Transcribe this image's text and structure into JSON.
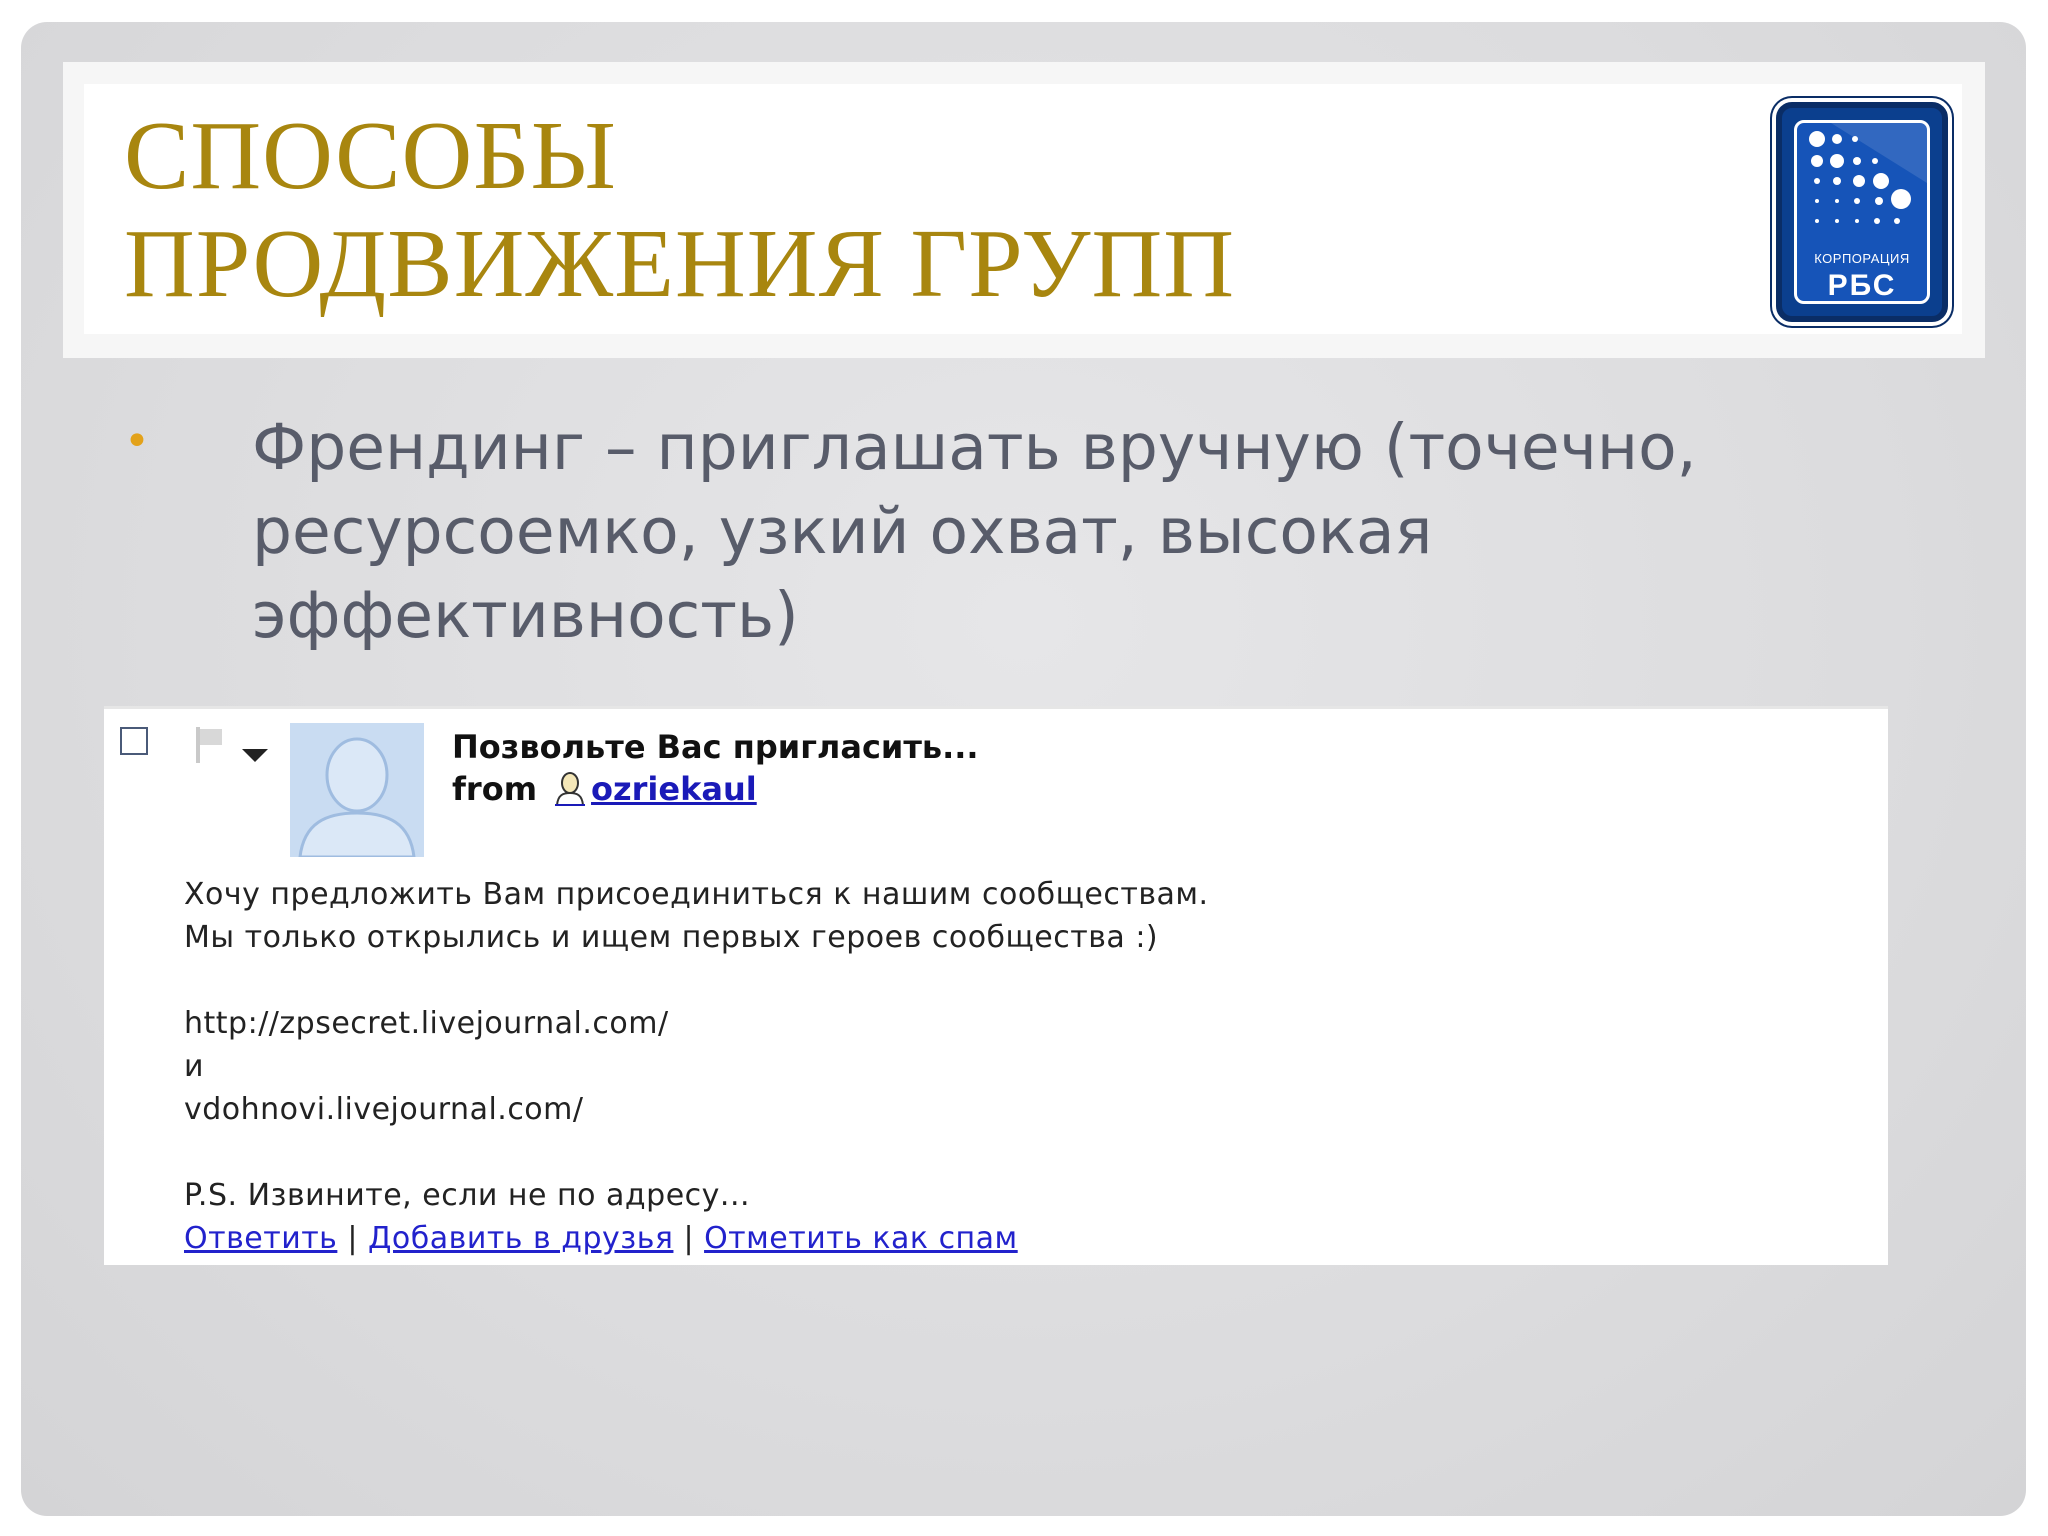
{
  "slide": {
    "title_line1": "СПОСОБЫ",
    "title_line2": "ПРОДВИЖЕНИЯ ГРУПП",
    "logo": {
      "caption": "КОРПОРАЦИЯ",
      "name": "РБС"
    },
    "bullets": [
      {
        "marker": "•",
        "text": "Френдинг – приглашать вручную (точечно, ресурсоемко, узкий охват, высокая эффективность)"
      }
    ]
  },
  "message": {
    "subject": "Позвольте Вас пригласить...",
    "from_label": "from",
    "from_user": "ozriekaul",
    "body_lines": [
      "Хочу предложить Вам присоединиться к нашим сообществам.",
      "Мы только открылись и ищем первых героев сообщества :)",
      "",
      "http://zpsecret.livejournal.com/",
      "и",
      "vdohnovi.livejournal.com/",
      "",
      "P.S. Извините, если не по адресу..."
    ],
    "actions": {
      "reply": "Ответить",
      "add_friend": "Добавить в друзья",
      "mark_spam": "Отметить как спам",
      "separator": "|"
    }
  },
  "colors": {
    "title": "#a8860f",
    "bullet_marker": "#e3a21a",
    "bullet_text": "#585c6a",
    "link": "#2222cc",
    "logo_blue": "#0b3f8e"
  }
}
